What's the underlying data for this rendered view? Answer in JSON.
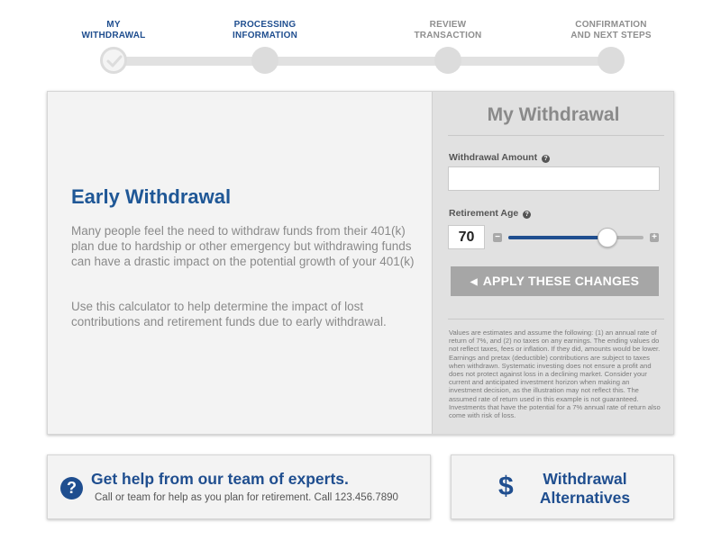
{
  "stepper": {
    "steps": [
      {
        "label": "MY\nWITHDRAWAL",
        "state": "completed"
      },
      {
        "label": "PROCESSING\nINFORMATION",
        "state": "active"
      },
      {
        "label": "REVIEW\nTRANSACTION",
        "state": "inactive"
      },
      {
        "label": "CONFIRMATION\nAND NEXT STEPS",
        "state": "inactive"
      }
    ]
  },
  "intro": {
    "title": "Early Withdrawal",
    "paragraph1": "Many people feel the need to withdraw funds from their 401(k) plan due to hardship or other emergency but withdrawing funds can have a drastic impact on the potential growth of your 401(k)",
    "paragraph2": "Use this calculator to help determine the impact of lost contributions and retirement funds due to early withdrawal."
  },
  "calculator": {
    "title": "My Withdrawal",
    "withdrawal_amount_label": "Withdrawal Amount",
    "withdrawal_amount_value": "",
    "help_glyph": "?",
    "retirement_age_label": "Retirement Age",
    "retirement_age_value": "70",
    "slider_fraction": 0.73,
    "minus_glyph": "−",
    "plus_glyph": "+",
    "apply_label": "APPLY THESE CHANGES",
    "disclaimer": "Values are estimates and assume the following: (1) an annual rate of return of 7%, and (2) no taxes on any earnings. The ending values do not reflect taxes, fees or inflation. If they did, amounts would be lower. Earnings and pretax (deductible) contributions are subject to taxes when withdrawn. Systematic investing does not ensure a profit and does not protect against loss in a declining market. Consider your current and anticipated investment horizon when making an investment decision, as the illustration may not reflect this. The assumed rate of return used in this example is not guaranteed. Investments that have the potential for a 7% annual rate of return also come with risk of loss."
  },
  "help_card": {
    "icon_glyph": "?",
    "title": "Get help from our team of experts.",
    "subtitle": "Call or team for help as you plan for retirement. Call 123.456.7890"
  },
  "alternatives_card": {
    "icon_glyph": "$",
    "title": "Withdrawal Alternatives"
  },
  "colors": {
    "accent": "#1f4e8f",
    "heading": "#1f5796",
    "muted_text": "#8a8a8a",
    "button_gray": "#a6a6a6"
  }
}
